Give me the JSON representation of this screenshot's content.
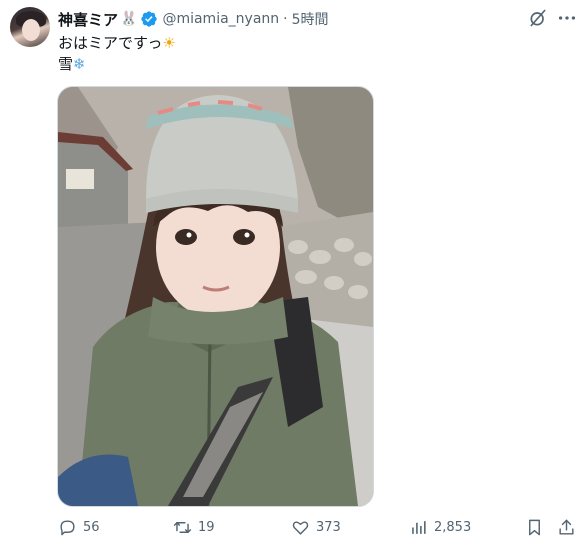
{
  "author": {
    "display_name": "神喜ミア",
    "name_emoji": "🐰",
    "handle": "@miamia_nyann",
    "separator": "·",
    "time": "5時間",
    "verified": true
  },
  "tweet": {
    "line1": "おはミアですっ",
    "line1_emoji": "☀",
    "line2": "雪",
    "line2_emoji": "❄"
  },
  "stats": {
    "replies": "56",
    "retweets": "19",
    "likes": "373",
    "views": "2,853"
  },
  "colors": {
    "text_primary": "#0f1419",
    "text_secondary": "#536471",
    "verified_blue": "#1d9bf0",
    "border": "#cfd9de"
  },
  "icons": [
    "grok-icon",
    "more-icon",
    "reply-icon",
    "retweet-icon",
    "like-icon",
    "views-icon",
    "bookmark-icon",
    "share-icon",
    "verified-badge-icon"
  ]
}
